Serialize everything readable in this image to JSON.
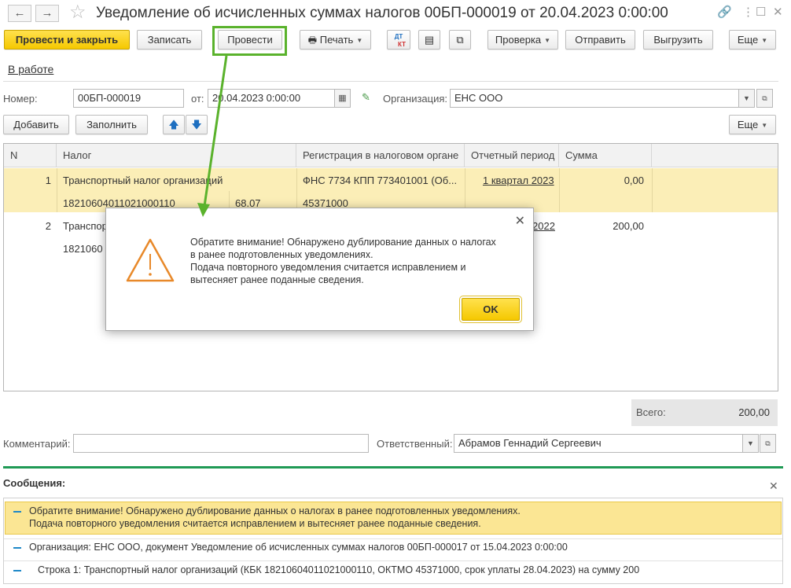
{
  "window": {
    "title": "Уведомление об исчисленных суммах налогов 00БП-000019 от 20.04.2023 0:00:00"
  },
  "toolbar": {
    "post_close": "Провести и закрыть",
    "save": "Записать",
    "post": "Провести",
    "print": "Печать",
    "check": "Проверка",
    "send": "Отправить",
    "export": "Выгрузить",
    "more": "Еще",
    "dt_kt_top": "ДТ",
    "dt_kt_bottom": "КТ"
  },
  "status_link": "В работе",
  "form": {
    "number_label": "Номер:",
    "number_value": "00БП-000019",
    "date_label": "от:",
    "date_value": "20.04.2023  0:00:00",
    "org_label": "Организация:",
    "org_value": "ЕНС ООО"
  },
  "table_toolbar": {
    "add": "Добавить",
    "fill": "Заполнить",
    "more": "Еще"
  },
  "table": {
    "headers": [
      "N",
      "Налог",
      "Регистрация в налоговом органе",
      "Отчетный период",
      "Сумма"
    ],
    "rows": [
      {
        "n": "1",
        "tax": "Транспортный налог организаций",
        "kbk": "18210604011021000110",
        "account": "68.07",
        "registration": "ФНС 7734 КПП 773401001 (Об...",
        "oktmo": "45371000",
        "period": "1 квартал 2023",
        "amount": "0,00"
      },
      {
        "n": "2",
        "tax": "Транспор",
        "kbk": "1821060",
        "period": "2022",
        "amount": "200,00"
      }
    ]
  },
  "dialog": {
    "line1": "Обратите внимание! Обнаружено дублирование данных о налогах",
    "line2": "в ранее подготовленных уведомлениях.",
    "line3": "Подача повторного уведомления считается исправлением и",
    "line4": "вытесняет ранее поданные сведения.",
    "ok": "OK"
  },
  "totals": {
    "label": "Всего:",
    "value": "200,00"
  },
  "bottom": {
    "comment_label": "Комментарий:",
    "comment_value": "",
    "responsible_label": "Ответственный:",
    "responsible_value": "Абрамов Геннадий Сергеевич"
  },
  "messages": {
    "title": "Сообщения:",
    "items": [
      "Обратите внимание! Обнаружено дублирование данных о налогах в ранее подготовленных уведомлениях.",
      "Подача повторного уведомления считается исправлением и вытесняет ранее поданные сведения.",
      "Организация: ЕНС ООО, документ Уведомление об исчисленных суммах налогов 00БП-000017 от 15.04.2023 0:00:00",
      "Строка 1: Транспортный налог организаций (КБК 18210604011021000110, ОКТМО 45371000, срок уплаты 28.04.2023) на сумму 200"
    ]
  },
  "colors": {
    "accent_yellow": "#f5c800",
    "annotation_green": "#5ab22c",
    "messages_line": "#1f9a55",
    "row_highlight": "#fbeeb7"
  }
}
